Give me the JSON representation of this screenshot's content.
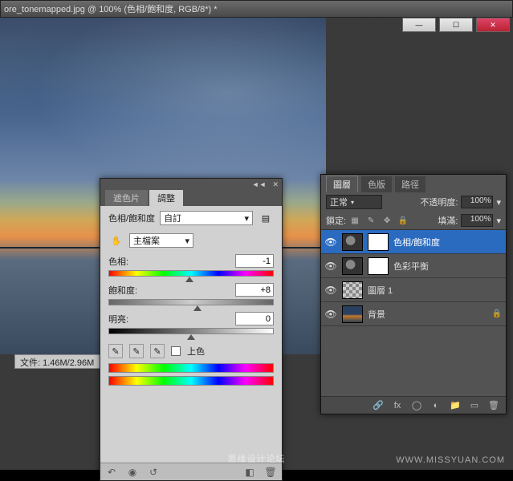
{
  "window": {
    "title": "ore_tonemapped.jpg @ 100% (色相/飽和度, RGB/8*) *"
  },
  "status_bar": "文件: 1.46M/2.96M",
  "aux": {
    "min": "—",
    "max": "☐",
    "close": "✕"
  },
  "adjust_panel": {
    "header_collapse": "◄◄",
    "header_close": "✕",
    "tabs": {
      "t1": "遮色片",
      "t2": "調整"
    },
    "type_label": "色相/飽和度",
    "preset": "自訂",
    "preset_caret": "▾",
    "menu_icon": "▤",
    "hand_icon": "✋",
    "master": "主檔案",
    "master_caret": "▾",
    "hue_label": "色相:",
    "hue_value": "-1",
    "sat_label": "飽和度:",
    "sat_value": "+8",
    "light_label": "明亮:",
    "light_value": "0",
    "colorize": "上色",
    "eyedropper": "✎",
    "foot_back": "↶",
    "foot_view": "◉",
    "foot_reset": "↺",
    "foot_clip": "◧",
    "foot_trash": "🗑"
  },
  "layers_panel": {
    "tabs": {
      "t1": "圖層",
      "t2": "色版",
      "t3": "路徑"
    },
    "blend": "正常",
    "caret": "▾",
    "opacity_label": "不透明度:",
    "opacity_value": "100%",
    "lock_label": "鎖定:",
    "fill_label": "填滿:",
    "fill_value": "100%",
    "lock_all": "▦",
    "lock_paint": "✎",
    "lock_pos": "✥",
    "lock_lock": "🔒",
    "eye": "👁",
    "layers": [
      {
        "name": "色相/飽和度"
      },
      {
        "name": "色彩平衡"
      },
      {
        "name": "圖層 1"
      },
      {
        "name": "背景"
      }
    ],
    "foot_link": "🔗",
    "foot_fx": "fx",
    "foot_mask": "◯",
    "foot_adj": "◐",
    "foot_folder": "📁",
    "foot_new": "▭",
    "foot_trash": "🗑"
  },
  "watermark": {
    "center": "思缘设计论坛",
    "right": "WWW.MISSYUAN.COM"
  }
}
